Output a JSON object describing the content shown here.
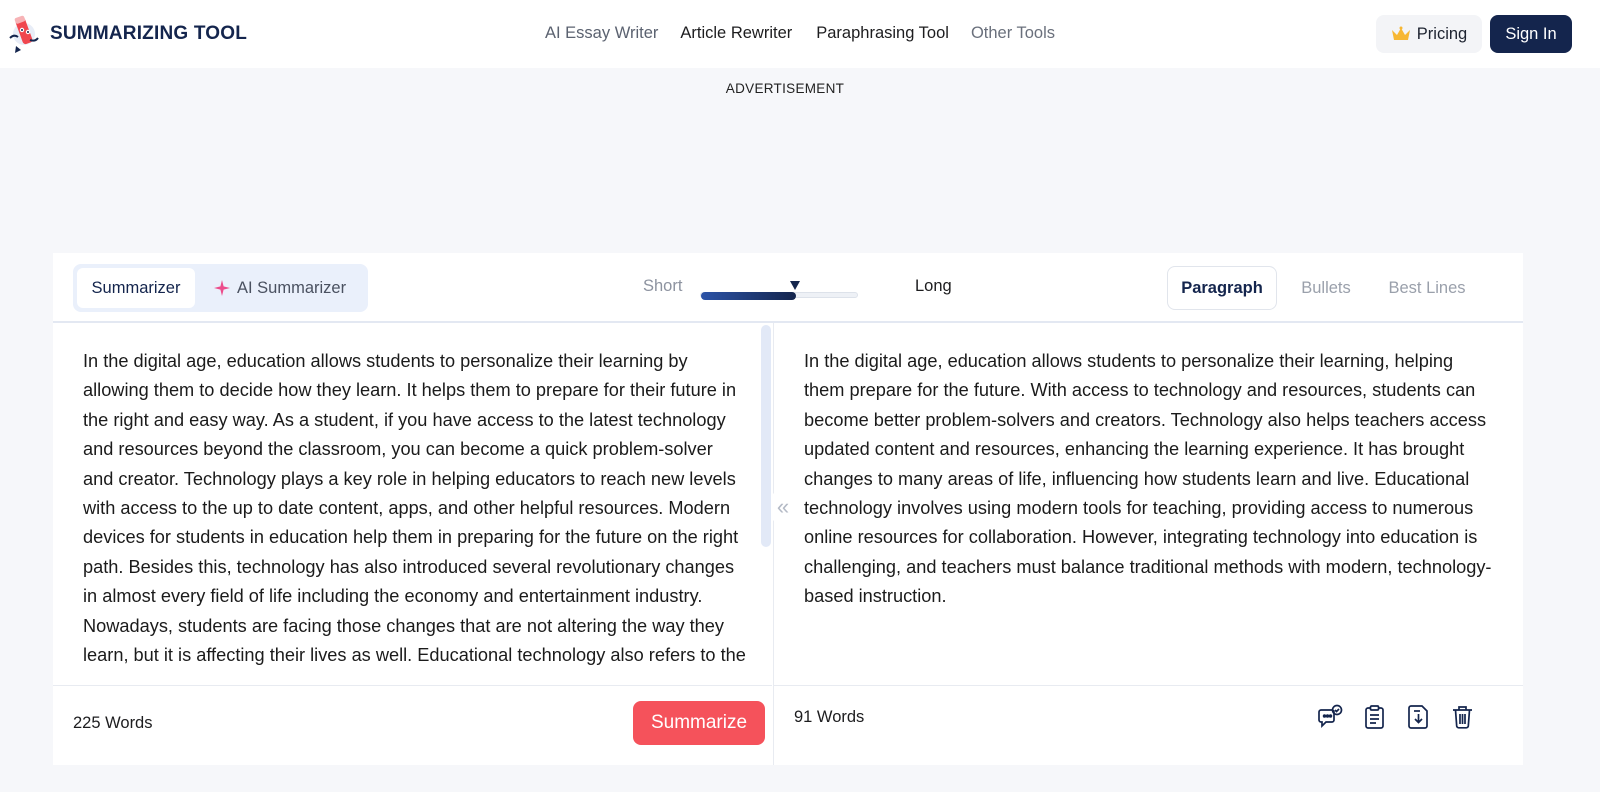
{
  "header": {
    "brand": "SUMMARIZING TOOL",
    "nav": [
      "AI Essay Writer",
      "Article Rewriter",
      "Paraphrasing Tool",
      "Other Tools"
    ],
    "pricing_label": "Pricing",
    "signin_label": "Sign In"
  },
  "ad_label": "ADVERTISEMENT",
  "toolbar": {
    "modes": [
      "Summarizer",
      "AI Summarizer"
    ],
    "length": {
      "short_label": "Short",
      "long_label": "Long",
      "level": 0.6
    },
    "formats": [
      "Paragraph",
      "Bullets",
      "Best Lines"
    ]
  },
  "input": {
    "text": "In the digital age, education allows students to personalize their learning by allowing them to decide how they learn. It helps them to prepare for their future in the right and easy way. As a student, if you have access to the latest technology and resources beyond the classroom, you can become a quick problem-solver and creator.  Technology plays a key role in helping educators to reach new levels with access to the up to date content, apps, and other helpful resources. Modern devices for students in education help them in preparing for the future on the right path.  Besides this, technology has also introduced several revolutionary changes in almost every field of life including the economy and entertainment industry. Nowadays, students are facing those changes that are not altering the way they learn, but it is affecting their lives as well. Educational technology also refers to the",
    "word_count": "225 Words",
    "summarize_label": "Summarize"
  },
  "output": {
    "text": "In the digital age, education allows students to personalize their learning, helping them prepare for the future. With access to technology and resources, students can become better problem-solvers and creators. Technology also helps teachers access updated content and resources, enhancing the learning experience. It has brought changes to many areas of life, influencing how students learn and live. Educational technology involves using modern tools for teaching, providing access to numerous online resources for collaboration. However, integrating technology into education is challenging, and teachers must balance traditional methods with modern, technology-based instruction.",
    "word_count": "91  Words",
    "actions": [
      "feedback-icon",
      "clipboard-icon",
      "download-icon",
      "trash-icon"
    ]
  },
  "colors": {
    "navy": "#14254d",
    "summarize_red": "#f5525b",
    "page_bg": "#f6f7fa"
  }
}
